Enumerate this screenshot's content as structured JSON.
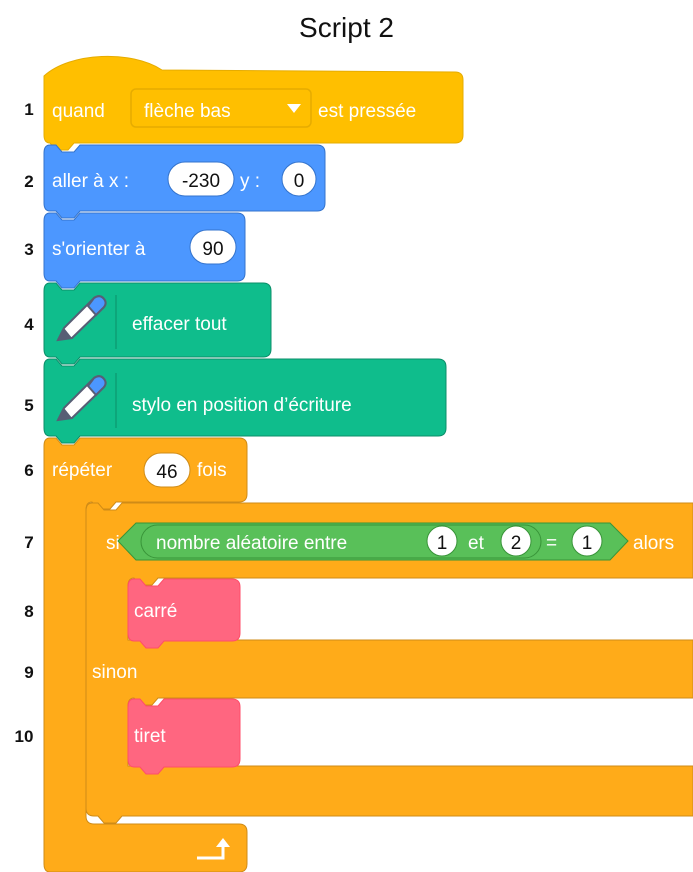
{
  "title": "Script 2",
  "line_numbers": [
    "1",
    "2",
    "3",
    "4",
    "5",
    "6",
    "7",
    "8",
    "9",
    "10"
  ],
  "blocks": {
    "when_key": {
      "label_when": "quand",
      "key": "flèche bas",
      "label_pressed": "est pressée"
    },
    "goto": {
      "label": "aller à x :",
      "x_value": "-230",
      "label_y": "y :",
      "y_value": "0"
    },
    "point": {
      "label": "s'orienter à",
      "value": "90"
    },
    "clear": {
      "label": "effacer tout"
    },
    "pen_down": {
      "label": "stylo en position d’écriture"
    },
    "repeat": {
      "label_repeat": "répéter",
      "count": "46",
      "label_times": "fois"
    },
    "if_else": {
      "label_if": "si",
      "condition_text": "nombre aléatoire entre",
      "rand_from": "1",
      "label_and": "et",
      "rand_to": "2",
      "equals": "=",
      "compare_value": "1",
      "label_then": "alors",
      "label_else": "sinon"
    },
    "custom1": {
      "label": "carré"
    },
    "custom2": {
      "label": "tiret"
    }
  },
  "colors": {
    "events": "#FFBF00",
    "motion": "#4C97FF",
    "pen": "#0FBD8C",
    "control": "#FFAB19",
    "operators": "#59C059",
    "custom": "#FF6680"
  }
}
